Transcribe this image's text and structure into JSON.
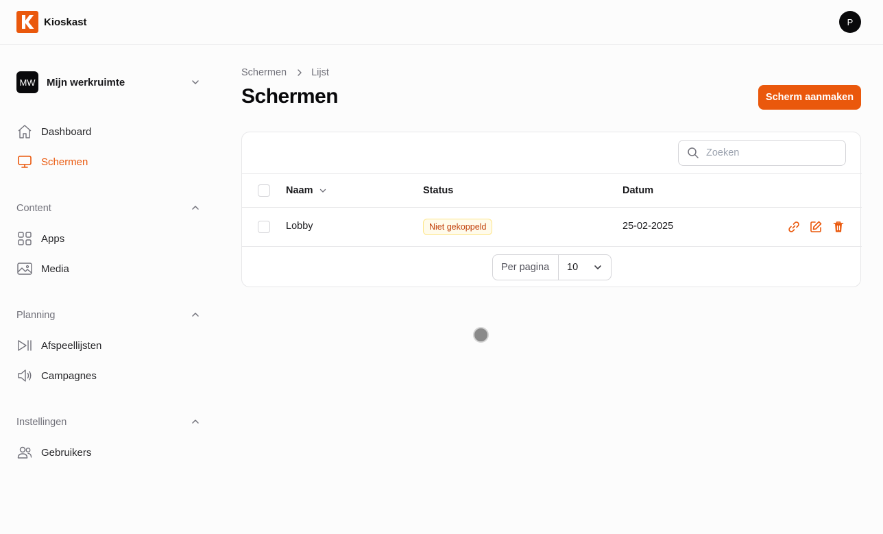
{
  "app": {
    "name": "Kioskast",
    "logo_letter": "K",
    "user_initial": "P",
    "accent": "#ea580c"
  },
  "workspace": {
    "initials": "MW",
    "name": "Mijn werkruimte"
  },
  "sidebar": {
    "top_items": [
      {
        "label": "Dashboard",
        "icon": "home-icon"
      },
      {
        "label": "Schermen",
        "icon": "monitor-icon",
        "active": true
      }
    ],
    "sections": [
      {
        "title": "Content",
        "items": [
          {
            "label": "Apps",
            "icon": "grid-icon"
          },
          {
            "label": "Media",
            "icon": "image-icon"
          }
        ]
      },
      {
        "title": "Planning",
        "items": [
          {
            "label": "Afspeellijsten",
            "icon": "play-list-icon"
          },
          {
            "label": "Campagnes",
            "icon": "megaphone-icon"
          }
        ]
      },
      {
        "title": "Instellingen",
        "items": [
          {
            "label": "Gebruikers",
            "icon": "users-icon"
          }
        ]
      }
    ]
  },
  "breadcrumb": {
    "parent": "Schermen",
    "current": "Lijst"
  },
  "page": {
    "title": "Schermen",
    "create_button": "Scherm aanmaken"
  },
  "table": {
    "search_placeholder": "Zoeken",
    "columns": {
      "name": "Naam",
      "status": "Status",
      "date": "Datum"
    },
    "rows": [
      {
        "name": "Lobby",
        "status": "Niet gekoppeld",
        "date": "25-02-2025"
      }
    ],
    "pagination": {
      "per_page_label": "Per pagina",
      "per_page_value": "10"
    }
  }
}
